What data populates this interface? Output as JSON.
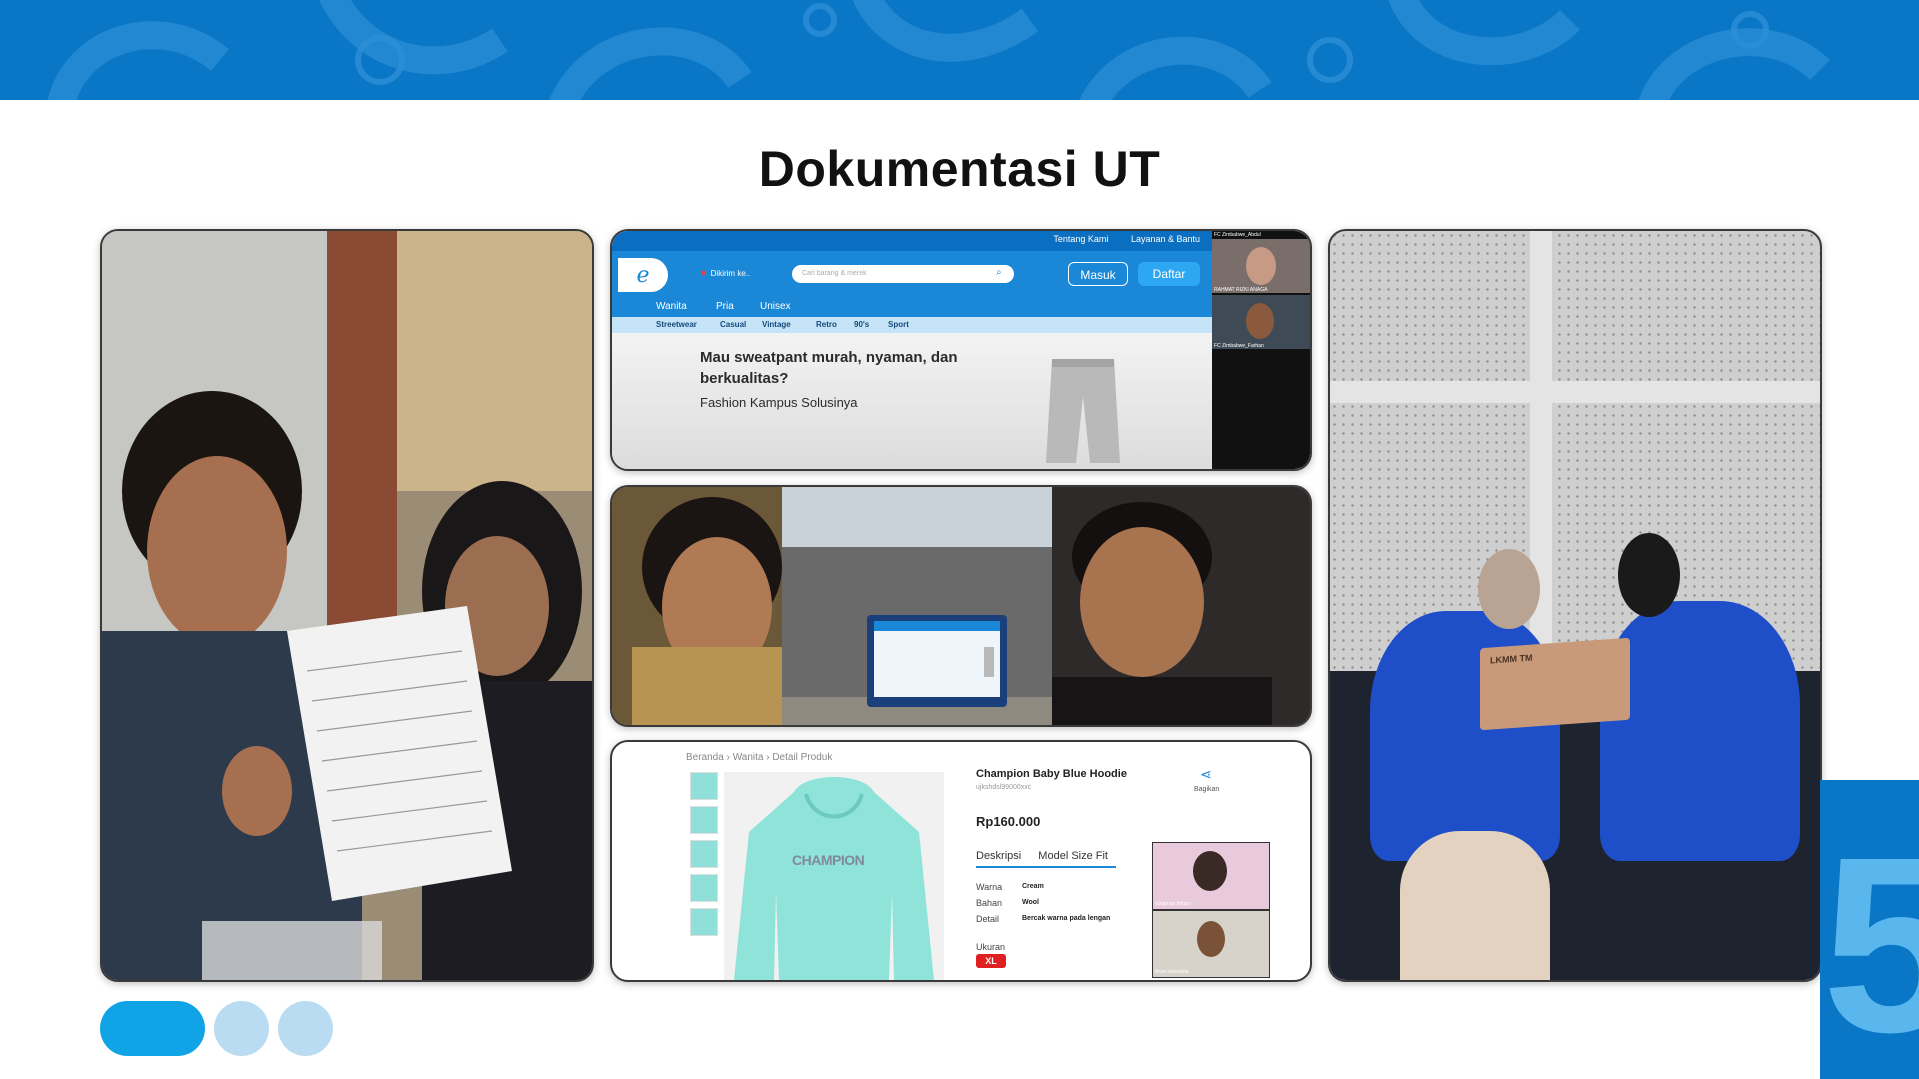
{
  "slide": {
    "title": "Dokumentasi UT",
    "page_number": "5",
    "colors": {
      "banner": "#0a76c6",
      "accent": "#10a4e6",
      "dot_inactive": "#b9dcf2"
    }
  },
  "website_shot": {
    "top_links": [
      "Tentang Kami",
      "Layanan & Bantu"
    ],
    "location": "Dikirim ke..",
    "search_placeholder": "Cari barang & merek",
    "login_label": "Masuk",
    "register_label": "Daftar",
    "nav": [
      "Wanita",
      "Pria",
      "Unisex"
    ],
    "subnav": [
      "Streetwear",
      "Casual",
      "Vintage",
      "Retro",
      "90's",
      "Sport"
    ],
    "hero_heading": "Mau sweatpant murah, nyaman, dan berkualitas?",
    "hero_sub": "Fashion Kampus Solusinya",
    "participants": [
      "FC Zimbabwe_Abdul",
      "RAHMAT RIZKI ANAGA",
      "FC Zimbabwe_Farhan"
    ]
  },
  "product_shot": {
    "breadcrumb": "Beranda › Wanita › Detail Produk",
    "name": "Champion Baby Blue Hoodie",
    "sku": "ujkshdsl99000xxc",
    "price": "Rp160.000",
    "share_label": "Bagikan",
    "tabs": [
      "Deskripsi",
      "Model Size Fit"
    ],
    "attributes": [
      {
        "label": "Warna",
        "value": "Cream"
      },
      {
        "label": "Bahan",
        "value": "Wool"
      },
      {
        "label": "Detail",
        "value": "Bercak warna pada lengan"
      }
    ],
    "size_label": "Ukuran",
    "size_value": "XL",
    "hoodie_print": "CHAMPION",
    "participants": [
      "idzqonah brkaro",
      "ilham krisnanta"
    ]
  },
  "right_photo": {
    "laptop_logo": "LKMM TM"
  },
  "pagination": {
    "total": 3,
    "active": 1
  }
}
